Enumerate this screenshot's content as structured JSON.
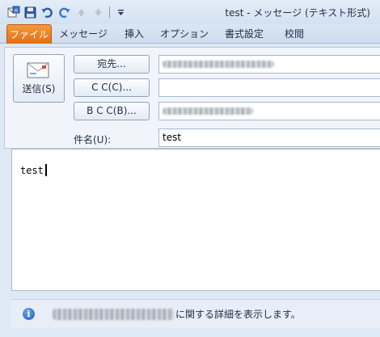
{
  "window": {
    "title": "test - メッセージ (テキスト形式)"
  },
  "quick_access": {
    "icons": [
      "outlook-icon",
      "save-icon",
      "undo-icon",
      "redo-icon",
      "up-arrow-icon",
      "down-arrow-icon",
      "customize-icon"
    ]
  },
  "ribbon": {
    "tabs": [
      "ファイル",
      "メッセージ",
      "挿入",
      "オプション",
      "書式設定",
      "校閲"
    ],
    "active_tab": "ファイル",
    "file_tab_color": "#e26d12"
  },
  "compose": {
    "send_label": "送信(S)",
    "to_button": "宛先...",
    "cc_button": "C C(C)...",
    "bcc_button": "B C C(B)...",
    "to_value": "",
    "cc_value": "",
    "bcc_value": "",
    "subject_label": "件名(U):",
    "subject_value": "test",
    "body_text": "test"
  },
  "infobar": {
    "text": "に関する詳細を表示します。"
  }
}
